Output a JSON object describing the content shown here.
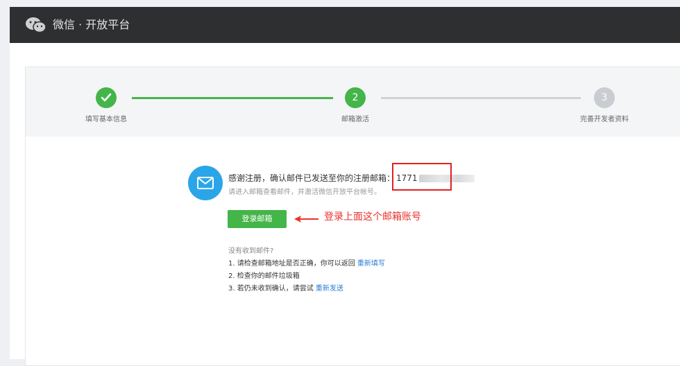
{
  "header": {
    "title": "微信 · 开放平台"
  },
  "steps": [
    {
      "label": "填写基本信息",
      "marker": "",
      "status": "done"
    },
    {
      "label": "邮箱激活",
      "marker": "2",
      "status": "current"
    },
    {
      "label": "完善开发者资料",
      "marker": "3",
      "status": "pending"
    }
  ],
  "confirm": {
    "message": "感谢注册，确认邮件已发送至你的注册邮箱：",
    "email_visible": "1771",
    "sub_message": "请进入邮箱查看邮件，并激活微信开放平台帐号。"
  },
  "login_button": "登录邮箱",
  "annotation": "登录上面这个邮箱账号",
  "help": {
    "question": "没有收到邮件?",
    "item1_text": "1. 请检查邮箱地址是否正确，你可以返回",
    "item1_link": "重新填写",
    "item2_text": "2. 检查你的邮件垃圾箱",
    "item3_text": "3. 若仍未收到确认，请尝试",
    "item3_link": "重新发送"
  },
  "colors": {
    "header_bg": "#2e2f31",
    "accent_green": "#44b549",
    "mail_blue": "#2aa6e8",
    "link_blue": "#2a7dd6",
    "annotation_red": "#e8322d"
  },
  "icons": {
    "logo": "wechat-logo-icon",
    "step_done": "checkmark-icon",
    "mail": "envelope-icon",
    "arrow": "red-arrow-left-icon"
  }
}
